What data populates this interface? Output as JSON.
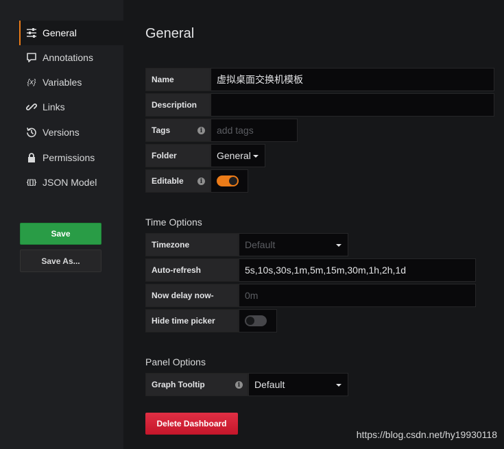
{
  "sidebar": {
    "items": [
      {
        "label": "General",
        "icon": "sliders-icon",
        "active": true
      },
      {
        "label": "Annotations",
        "icon": "comment-icon"
      },
      {
        "label": "Variables",
        "icon": "variable-icon",
        "glyph": "{x}"
      },
      {
        "label": "Links",
        "icon": "link-icon"
      },
      {
        "label": "Versions",
        "icon": "history-icon"
      },
      {
        "label": "Permissions",
        "icon": "lock-icon"
      },
      {
        "label": "JSON Model",
        "icon": "json-icon",
        "glyph": "{[]}"
      }
    ],
    "save_label": "Save",
    "save_as_label": "Save As..."
  },
  "main": {
    "title": "General",
    "name": {
      "label": "Name",
      "value": "虚拟桌面交换机模板"
    },
    "description": {
      "label": "Description",
      "value": ""
    },
    "tags": {
      "label": "Tags",
      "placeholder": "add tags"
    },
    "folder": {
      "label": "Folder",
      "value": "General"
    },
    "editable": {
      "label": "Editable",
      "on": true
    }
  },
  "time_options": {
    "title": "Time Options",
    "timezone": {
      "label": "Timezone",
      "placeholder": "Default"
    },
    "auto_refresh": {
      "label": "Auto-refresh",
      "value": "5s,10s,30s,1m,5m,15m,30m,1h,2h,1d"
    },
    "now_delay": {
      "label": "Now delay now-",
      "placeholder": "0m"
    },
    "hide_time_picker": {
      "label": "Hide time picker",
      "on": false
    }
  },
  "panel_options": {
    "title": "Panel Options",
    "graph_tooltip": {
      "label": "Graph Tooltip",
      "value": "Default"
    }
  },
  "delete_label": "Delete Dashboard",
  "watermark": "https://blog.csdn.net/hy19930118",
  "colors": {
    "accent": "#eb7b18",
    "save": "#299c46",
    "delete": "#e02f44",
    "background": "#161719",
    "sidebar": "#1e1f22"
  }
}
